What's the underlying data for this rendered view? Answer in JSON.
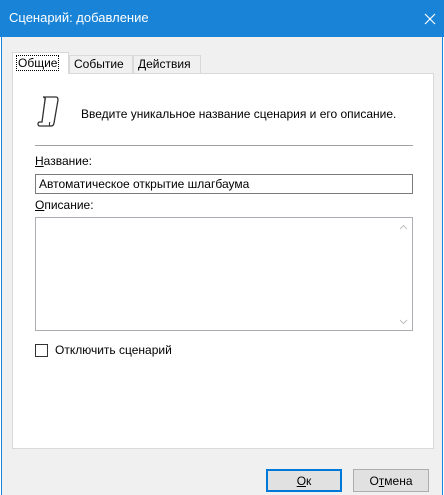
{
  "window": {
    "title": "Сценарий: добавление",
    "close_icon": "close-icon",
    "accent_color": "#1883d7"
  },
  "tabs": [
    {
      "label": "Общие",
      "active": true
    },
    {
      "label": "Событие",
      "active": false
    },
    {
      "label": "Действия",
      "active": false
    }
  ],
  "general": {
    "icon": "scroll-icon",
    "intro": "Введите уникальное название сценария и его описание.",
    "name_label_prefix": "Н",
    "name_label_rest": "азвание:",
    "name_value": "Автоматическое открытие шлагбаума",
    "desc_label_prefix": "О",
    "desc_label_rest": "писание:",
    "desc_value": "",
    "disable_label": "Отключить сценарий",
    "disable_checked": false
  },
  "buttons": {
    "ok_prefix": "О",
    "ok_rest": "к",
    "cancel_prefix": "О",
    "cancel_mid": "т",
    "cancel_rest": "мена"
  }
}
